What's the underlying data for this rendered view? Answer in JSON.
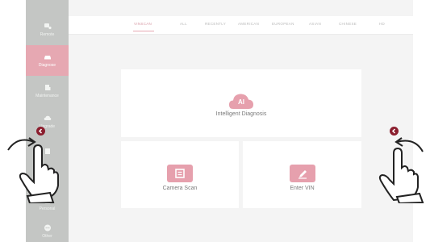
{
  "sidebar": {
    "items": [
      {
        "label": "Remote",
        "icon": "remote-icon",
        "active": false
      },
      {
        "label": "Diagnose",
        "icon": "car-icon",
        "active": true
      },
      {
        "label": "Maintenance",
        "icon": "wrench-icon",
        "active": false
      },
      {
        "label": "Upgrade",
        "icon": "cloud-upgrade-icon",
        "active": false
      },
      {
        "label": "",
        "icon": "tools-icon",
        "active": false
      },
      {
        "label": "",
        "icon": "shield-icon",
        "active": false
      },
      {
        "label": "Personal",
        "icon": "person-icon",
        "active": false
      },
      {
        "label": "Other",
        "icon": "dots-icon",
        "active": false
      }
    ]
  },
  "tabs": [
    {
      "label": "VINSCAN",
      "active": true
    },
    {
      "label": "ALL",
      "active": false
    },
    {
      "label": "RECENTLY",
      "active": false
    },
    {
      "label": "AMERICAN",
      "active": false
    },
    {
      "label": "EUROPEAN",
      "active": false
    },
    {
      "label": "ASIAN",
      "active": false
    },
    {
      "label": "CHINESE",
      "active": false
    },
    {
      "label": "HD",
      "active": false
    }
  ],
  "main": {
    "ai_badge": "AI",
    "intelligent_label": "Intelligent Diagnosis",
    "camera_label": "Camera Scan",
    "vin_label": "Enter VIN"
  },
  "colors": {
    "accent": "#e6a8b2",
    "nav_button": "#8b1e2e",
    "sidebar": "#c4c6c4"
  }
}
